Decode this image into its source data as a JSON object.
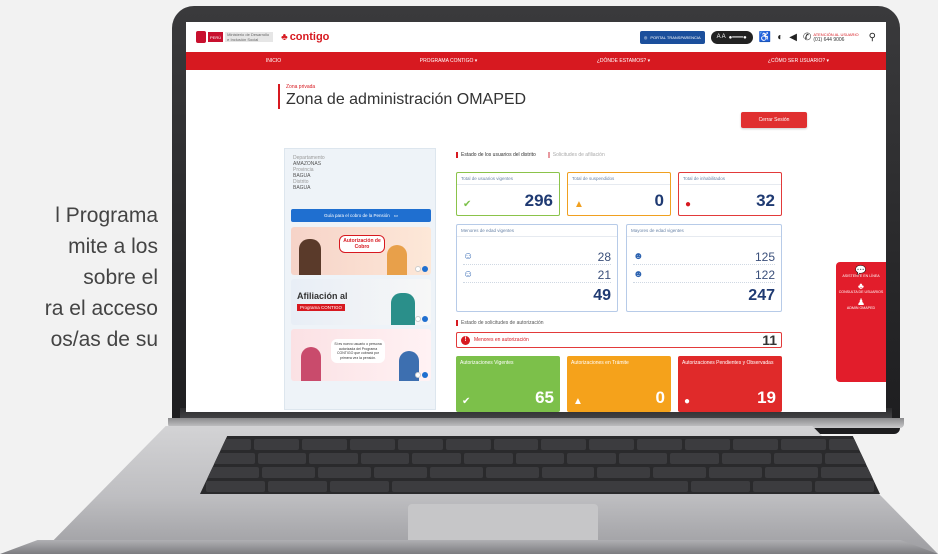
{
  "left_text": [
    "l Programa",
    "mite a los",
    "sobre el",
    "ra el acceso",
    "os/as de su"
  ],
  "header": {
    "gov_red": "PERÚ",
    "gov_grey": "Ministerio de Desarrollo e Inclusión Social",
    "brand": "contigo",
    "portal": "PORTAL TRANSPARENCIA",
    "access_text": "A A",
    "phone_label": "ATENCIÓN AL USUARIO",
    "phone_number": "(01) 644 9006"
  },
  "nav": [
    "INICIO",
    "PROGRAMA CONTIGO ▾",
    "¿DÓNDE ESTAMOS? ▾",
    "¿CÓMO SER USUARIO? ▾"
  ],
  "zone": {
    "small": "Zona privada",
    "title": "Zona de administración OMAPED",
    "logout": "Cerrar Sesión"
  },
  "location": [
    {
      "label": "Departamento",
      "value": "AMAZONAS"
    },
    {
      "label": "Provincia",
      "value": "BAGUA"
    },
    {
      "label": "Distrito",
      "value": "BAGUA"
    }
  ],
  "guide_button": "Guía para el cobro de la Pensión",
  "banners": {
    "b1": "Autorización de Cobro",
    "b2_title": "Afiliación al",
    "b2_tag": "Programa CONTIGO",
    "b3": "Si es nuevo usuario o persona autorizada del Programa CONTIGO que cobrará por primera vez la pensión."
  },
  "tabs": [
    "Estado de los usuarios del distrito",
    "Solicitudes de afiliación"
  ],
  "cards": [
    {
      "title": "Total de usuarios vigentes",
      "value": "296"
    },
    {
      "title": "Total de suspendidos",
      "value": "0"
    },
    {
      "title": "Total de inhabilitados",
      "value": "32"
    }
  ],
  "minors": {
    "title": "Menores de edad vigentes",
    "values": [
      "28",
      "21"
    ],
    "total": "49"
  },
  "adults": {
    "title": "Mayores de edad vigentes",
    "values": [
      "125",
      "122"
    ],
    "total": "247"
  },
  "solicitudes": {
    "title": "Estado de solicitudes de autorización",
    "menores_label": "Menores en autorización",
    "menores_value": "11"
  },
  "solid_cards": [
    {
      "label": "Autorizaciones Vigentes",
      "value": "65"
    },
    {
      "label": "Autorizaciones en Trámite",
      "value": "0"
    },
    {
      "label": "Autorizaciones Pendientes y Observadas",
      "value": "19"
    }
  ],
  "float_panel": [
    "ASISTENTE EN LÍNEA",
    "CONSULTA DE USUARIOS",
    "ADMIN OMAPED"
  ],
  "colors": {
    "brand_red": "#d71920",
    "green": "#7cc04a",
    "orange": "#f5a21b",
    "navy": "#1f3a72"
  }
}
